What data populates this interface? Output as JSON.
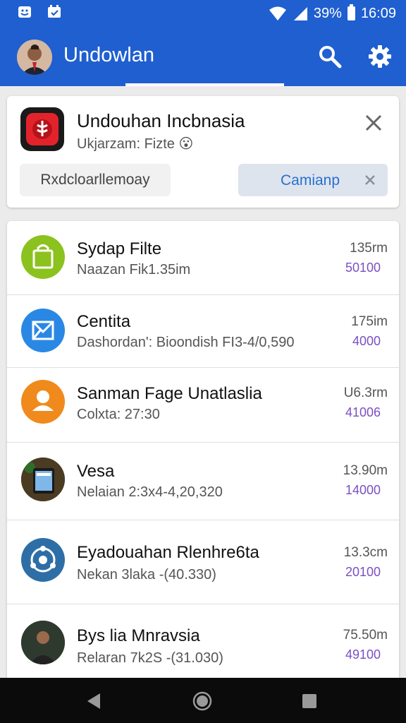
{
  "status_bar": {
    "battery_text": "39%",
    "time": "16:09"
  },
  "app_bar": {
    "title": "Undowlan"
  },
  "notification": {
    "title": "Undouhan Incbnasia",
    "subtitle": "Ukjarzam: Fizte 😮",
    "button_secondary": "Rxdcloarllemoay",
    "button_primary": "Camianp"
  },
  "downloads": [
    {
      "title": "Sydap Filte",
      "subtitle": "Naazan Fik1.35im",
      "size": "135rm",
      "count": "50100",
      "icon": "shopping-bag-icon",
      "color": "#8cc21d"
    },
    {
      "title": "Centita",
      "subtitle": "Dashordan': Bioondish FI3-4/0,590",
      "size": "175im",
      "count": "4000",
      "icon": "image-mail-icon",
      "color": "#2a88e4"
    },
    {
      "title": "Sanman Fage Unatlaslia",
      "subtitle": "Colxta: 27:30",
      "size": "U6.3rm",
      "count": "41006",
      "icon": "person-icon",
      "color": "#f08a1c"
    },
    {
      "title": "Vesa",
      "subtitle": "Nelaian 2:3x4-4,20,320",
      "size": "13.90m",
      "count": "14000",
      "icon": "tablet-photo-icon",
      "color": "#3d3a2c"
    },
    {
      "title": "Eyadouahan Rlenhre6ta",
      "subtitle": "Nekan 3laka -(40.330)",
      "size": "13.3cm",
      "count": "20100",
      "icon": "network-globe-icon",
      "color": "#2e6ea6"
    },
    {
      "title": "Bys lia Mnravsia",
      "subtitle": "Relaran 7k2S -(31.030)",
      "size": "75.50m",
      "count": "49100",
      "icon": "person-photo-icon",
      "color": "#3a3a3a"
    }
  ]
}
